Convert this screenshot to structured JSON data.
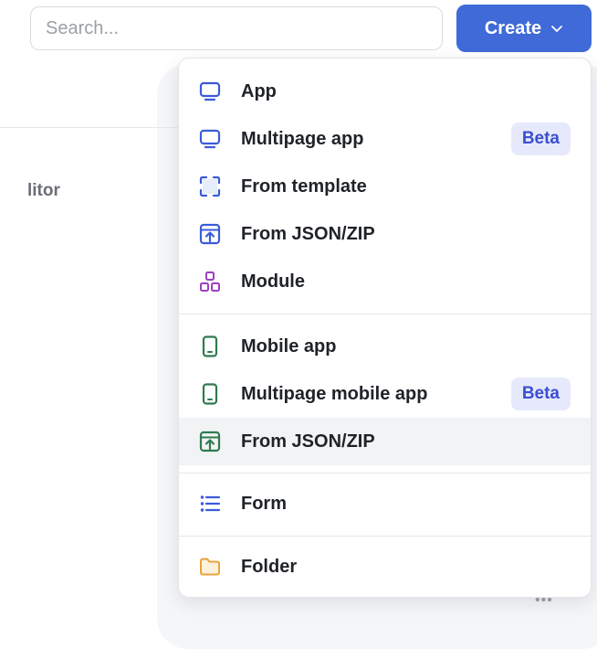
{
  "search": {
    "placeholder": "Search..."
  },
  "create_button": {
    "label": "Create"
  },
  "background": {
    "partial_text": "litor",
    "more_dots": "•••"
  },
  "menu": {
    "items": [
      {
        "label": "App",
        "icon": "monitor-icon",
        "color": "#3b5bd9"
      },
      {
        "label": "Multipage app",
        "icon": "monitor-icon",
        "color": "#3b5bd9",
        "badge": "Beta"
      },
      {
        "label": "From template",
        "icon": "template-frame-icon",
        "color": "#3b5bd9"
      },
      {
        "label": "From JSON/ZIP",
        "icon": "upload-box-icon",
        "color": "#3b5bd9"
      },
      {
        "label": "Module",
        "icon": "module-icon",
        "color": "#9b3fc1"
      },
      {
        "label": "Mobile app",
        "icon": "mobile-icon",
        "color": "#2f7a4f"
      },
      {
        "label": "Multipage mobile app",
        "icon": "mobile-icon",
        "color": "#2f7a4f",
        "badge": "Beta"
      },
      {
        "label": "From JSON/ZIP",
        "icon": "upload-box-icon",
        "color": "#2f7a4f",
        "hovered": true
      },
      {
        "label": "Form",
        "icon": "list-icon",
        "color": "#3b5bd9"
      },
      {
        "label": "Folder",
        "icon": "folder-icon",
        "color": "#e8a33c"
      }
    ]
  }
}
